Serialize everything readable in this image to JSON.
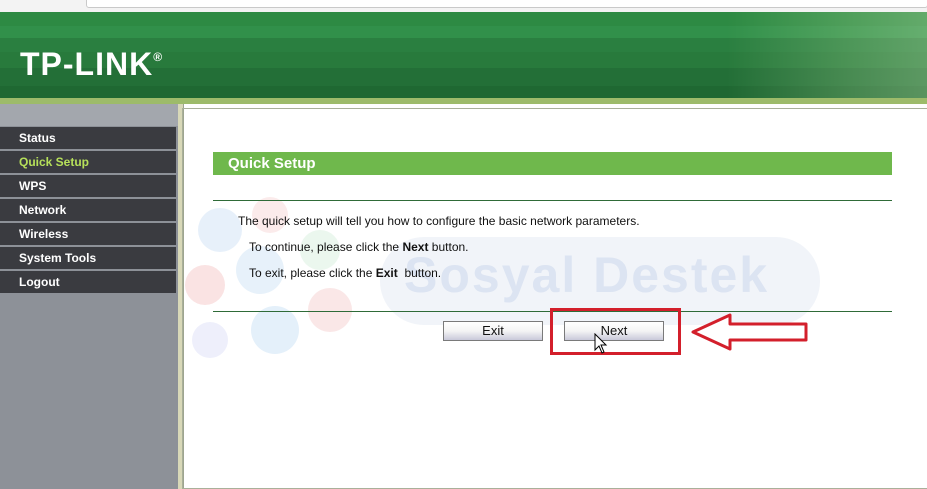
{
  "header": {
    "logo_text": "TP-LINK",
    "logo_mark": "®"
  },
  "sidebar": {
    "items": [
      {
        "label": "Status",
        "active": false
      },
      {
        "label": "Quick Setup",
        "active": true
      },
      {
        "label": "WPS",
        "active": false
      },
      {
        "label": "Network",
        "active": false
      },
      {
        "label": "Wireless",
        "active": false
      },
      {
        "label": "System Tools",
        "active": false
      },
      {
        "label": "Logout",
        "active": false
      }
    ]
  },
  "main": {
    "title": "Quick Setup",
    "intro": "The quick setup will tell you how to configure the basic network parameters.",
    "continue_prefix": "To continue, please click the",
    "continue_bold": "Next",
    "continue_suffix": "button.",
    "exit_prefix": "To exit, please click the",
    "exit_bold": "Exit",
    "exit_suffix": "button.",
    "exit_button": "Exit",
    "next_button": "Next"
  },
  "watermark": {
    "text": "Sosyal Destek"
  },
  "colors": {
    "header_green": "#2e7c40",
    "title_green": "#6fb84c",
    "menu_bg": "#3a3b40",
    "active_text": "#b6e05a",
    "annotation_red": "#d31f2b"
  }
}
